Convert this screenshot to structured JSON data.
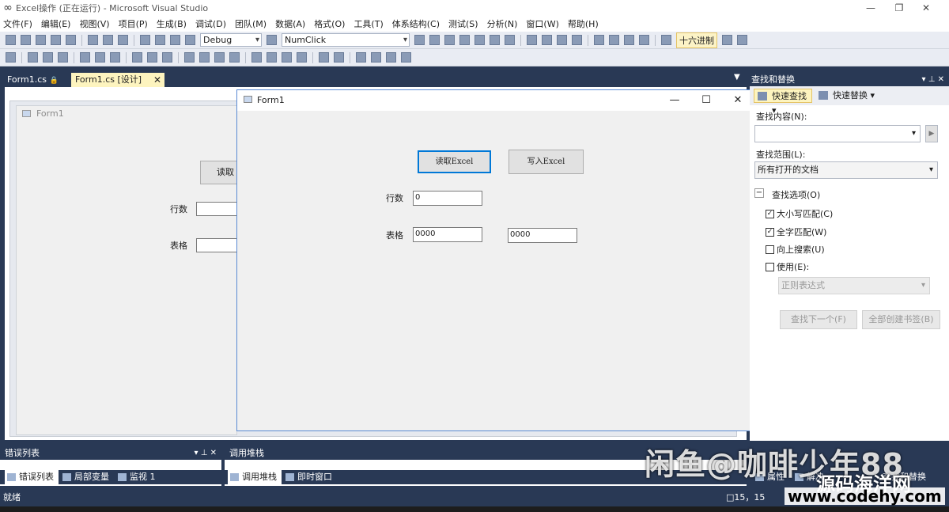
{
  "window": {
    "title": "Excel操作 (正在运行) - Microsoft Visual Studio",
    "minimize": "—",
    "restore": "❐",
    "close": "✕"
  },
  "menu": [
    "文件(F)",
    "编辑(E)",
    "视图(V)",
    "项目(P)",
    "生成(B)",
    "调试(D)",
    "团队(M)",
    "数据(A)",
    "格式(O)",
    "工具(T)",
    "体系结构(C)",
    "测试(S)",
    "分析(N)",
    "窗口(W)",
    "帮助(H)"
  ],
  "toolbar": {
    "config": "Debug",
    "target": "NumClick",
    "hex": "十六进制"
  },
  "tabs": {
    "tab1": "Form1.cs",
    "tab1_lock": "🔒",
    "tab2": "Form1.cs [设计]",
    "tab2_close": "✕"
  },
  "designer": {
    "form_title": "Form1",
    "btn_read": "读取Excel",
    "label_rows": "行数",
    "label_table": "表格"
  },
  "form1": {
    "title": "Form1",
    "btn_read": "读取Excel",
    "btn_write": "写入Excel",
    "label_rows": "行数",
    "rows_value": "0",
    "label_table": "表格",
    "table_value1": "0000",
    "table_value2": "0000"
  },
  "find": {
    "panel_title": "查找和替换",
    "quick_find": "快速查找",
    "quick_replace": "快速替换",
    "find_what_label": "查找内容(N):",
    "find_value": "",
    "scope_label": "查找范围(L):",
    "scope_value": "所有打开的文档",
    "options_header": "查找选项(O)",
    "match_case": "大小写匹配(C)",
    "whole_word": "全字匹配(W)",
    "search_up": "向上搜索(U)",
    "use": "使用(E):",
    "regex": "正则表达式",
    "find_next": "查找下一个(F)",
    "bookmark_all": "全部创建书签(B)"
  },
  "bottom": {
    "error_title": "错误列表",
    "call_title": "调用堆栈",
    "tab_errors": "错误列表",
    "tab_locals": "局部变量",
    "tab_watch": "监视 1",
    "tab_callstack": "调用堆栈",
    "tab_immediate": "即时窗口",
    "tab_props": "属性",
    "tab_sol": "解决",
    "tab_findrep": "查找和替换"
  },
  "status": {
    "ready": "就绪",
    "pos": "15，15"
  },
  "watermark": {
    "line1": "闲鱼@咖啡少年88",
    "line2": "源码海洋网",
    "line3": "www.codehy.com"
  }
}
